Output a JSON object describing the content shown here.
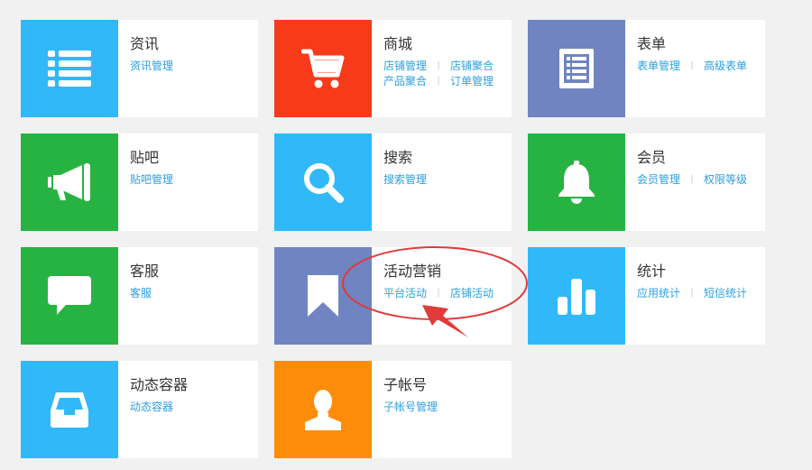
{
  "colors": {
    "blue": "#31b8f9",
    "red": "#f63a1a",
    "purple": "#7084c1",
    "green": "#27b342",
    "orange": "#fd8c0b",
    "link": "#2d9fe0",
    "title": "#333333",
    "annotation": "#e03a3a"
  },
  "cards": [
    {
      "title": "资讯",
      "icon": "list-icon",
      "color": "blue",
      "links": [
        "资讯管理"
      ]
    },
    {
      "title": "商城",
      "icon": "cart-icon",
      "color": "red",
      "links": [
        "店铺管理",
        "店铺聚合",
        "产品聚合",
        "订单管理"
      ]
    },
    {
      "title": "表单",
      "icon": "form-icon",
      "color": "purple",
      "links": [
        "表单管理",
        "高级表单"
      ]
    },
    {
      "title": "贴吧",
      "icon": "megaphone-icon",
      "color": "green",
      "links": [
        "贴吧管理"
      ]
    },
    {
      "title": "搜索",
      "icon": "search-icon",
      "color": "blue",
      "links": [
        "搜索管理"
      ]
    },
    {
      "title": "会员",
      "icon": "bell-icon",
      "color": "green",
      "links": [
        "会员管理",
        "权限等级"
      ]
    },
    {
      "title": "客服",
      "icon": "chat-bubble-icon",
      "color": "green",
      "links": [
        "客服"
      ]
    },
    {
      "title": "活动营销",
      "icon": "bookmark-icon",
      "color": "purple",
      "links": [
        "平台活动",
        "店铺活动"
      ]
    },
    {
      "title": "统计",
      "icon": "bar-chart-icon",
      "color": "blue",
      "links": [
        "应用统计",
        "短信统计"
      ]
    },
    {
      "title": "动态容器",
      "icon": "inbox-tray-icon",
      "color": "blue",
      "links": [
        "动态容器"
      ]
    },
    {
      "title": "子帐号",
      "icon": "user-icon",
      "color": "orange",
      "links": [
        "子帐号管理"
      ]
    }
  ]
}
